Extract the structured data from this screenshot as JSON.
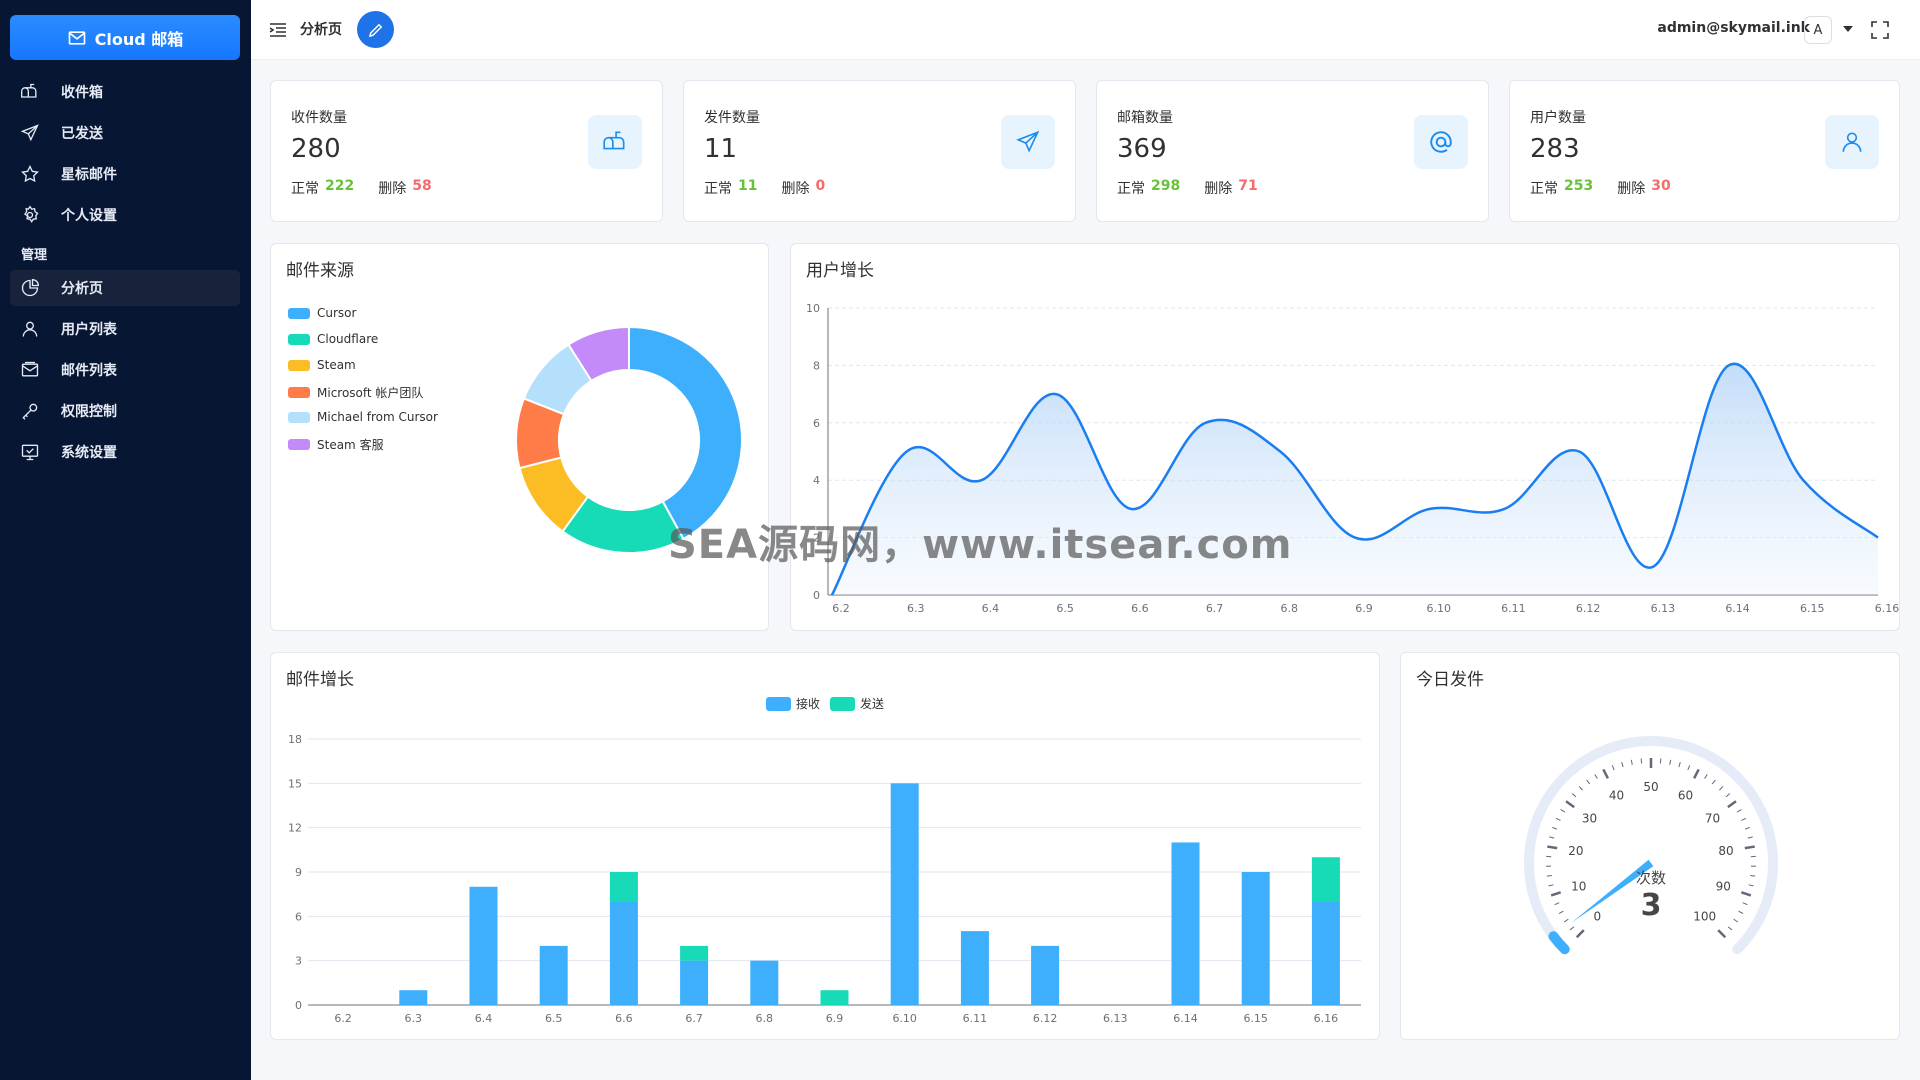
{
  "sidebar": {
    "brand": "Cloud 邮箱",
    "items": [
      {
        "label": "收件箱",
        "icon": "inbox-icon"
      },
      {
        "label": "已发送",
        "icon": "send-icon"
      },
      {
        "label": "星标邮件",
        "icon": "star-icon"
      },
      {
        "label": "个人设置",
        "icon": "gear-icon"
      }
    ],
    "section_label": "管理",
    "admin_items": [
      {
        "label": "分析页",
        "icon": "pie-chart-icon",
        "active": true
      },
      {
        "label": "用户列表",
        "icon": "user-icon"
      },
      {
        "label": "邮件列表",
        "icon": "mail-list-icon"
      },
      {
        "label": "权限控制",
        "icon": "key-icon"
      },
      {
        "label": "系统设置",
        "icon": "monitor-settings-icon"
      }
    ]
  },
  "header": {
    "page_name": "分析页",
    "account": "admin@skymail.ink",
    "avatar_letter": "A"
  },
  "stats": [
    {
      "title": "收件数量",
      "value": "280",
      "normal_label": "正常",
      "normal": "222",
      "deleted_label": "删除",
      "deleted": "58",
      "icon": "mailbox-icon"
    },
    {
      "title": "发件数量",
      "value": "11",
      "normal_label": "正常",
      "normal": "11",
      "deleted_label": "删除",
      "deleted": "0",
      "icon": "send-icon"
    },
    {
      "title": "邮箱数量",
      "value": "369",
      "normal_label": "正常",
      "normal": "298",
      "deleted_label": "删除",
      "deleted": "71",
      "icon": "at-icon"
    },
    {
      "title": "用户数量",
      "value": "283",
      "normal_label": "正常",
      "normal": "253",
      "deleted_label": "删除",
      "deleted": "30",
      "icon": "user-icon"
    }
  ],
  "panels": {
    "source_title": "邮件来源",
    "user_growth_title": "用户增长",
    "mail_growth_title": "邮件增长",
    "today_title": "今日发件"
  },
  "colors": {
    "blue": "#3eaffc",
    "teal": "#16dbb6",
    "yellow": "#fbbd23",
    "orange": "#ff7b48",
    "lightblue": "#b5e0fb",
    "purple": "#c38af9",
    "line": "#1a7ef0"
  },
  "chart_data": [
    {
      "type": "pie",
      "title": "邮件来源",
      "donut": true,
      "legend_position": "left",
      "slices": [
        {
          "name": "Cursor",
          "value": 42,
          "color": "#3eaffc"
        },
        {
          "name": "Cloudflare",
          "value": 18,
          "color": "#16dbb6"
        },
        {
          "name": "Steam",
          "value": 11,
          "color": "#fbbd23"
        },
        {
          "name": "Microsoft 帐户团队",
          "value": 10,
          "color": "#ff7b48"
        },
        {
          "name": "Michael from Cursor",
          "value": 10,
          "color": "#b5e0fb"
        },
        {
          "name": "Steam 客服",
          "value": 9,
          "color": "#c38af9"
        }
      ]
    },
    {
      "type": "area",
      "title": "用户增长",
      "x": [
        "6.2",
        "6.3",
        "6.4",
        "6.5",
        "6.6",
        "6.7",
        "6.8",
        "6.9",
        "6.10",
        "6.11",
        "6.12",
        "6.13",
        "6.14",
        "6.15",
        "6.16"
      ],
      "series": [
        {
          "values": [
            0,
            5,
            4,
            7,
            3,
            6,
            5,
            2,
            3,
            3,
            5,
            1,
            8,
            4,
            2
          ]
        }
      ],
      "ylim": [
        0,
        10
      ],
      "yticks": [
        0,
        2,
        4,
        6,
        8,
        10
      ],
      "smooth": true,
      "grid": true
    },
    {
      "type": "bar",
      "title": "邮件增长",
      "stacked": true,
      "legend_position": "top",
      "categories": [
        "6.2",
        "6.3",
        "6.4",
        "6.5",
        "6.6",
        "6.7",
        "6.8",
        "6.9",
        "6.10",
        "6.11",
        "6.12",
        "6.13",
        "6.14",
        "6.15",
        "6.16"
      ],
      "series": [
        {
          "name": "接收",
          "values": [
            0,
            1,
            8,
            4,
            7,
            3,
            3,
            0,
            15,
            5,
            4,
            0,
            11,
            9,
            7
          ]
        },
        {
          "name": "发送",
          "values": [
            0,
            0,
            0,
            0,
            2,
            1,
            0,
            1,
            0,
            0,
            0,
            0,
            0,
            0,
            3
          ]
        }
      ],
      "ylim": [
        0,
        18
      ],
      "yticks": [
        0,
        3,
        6,
        9,
        12,
        15,
        18
      ],
      "grid": true
    },
    {
      "type": "gauge",
      "title": "今日发件",
      "label": "次数",
      "value": 3,
      "min": 0,
      "max": 100,
      "ticks": [
        0,
        10,
        20,
        30,
        40,
        50,
        60,
        70,
        80,
        90,
        100
      ]
    }
  ],
  "watermark": "SEA源码网，www.itsear.com"
}
